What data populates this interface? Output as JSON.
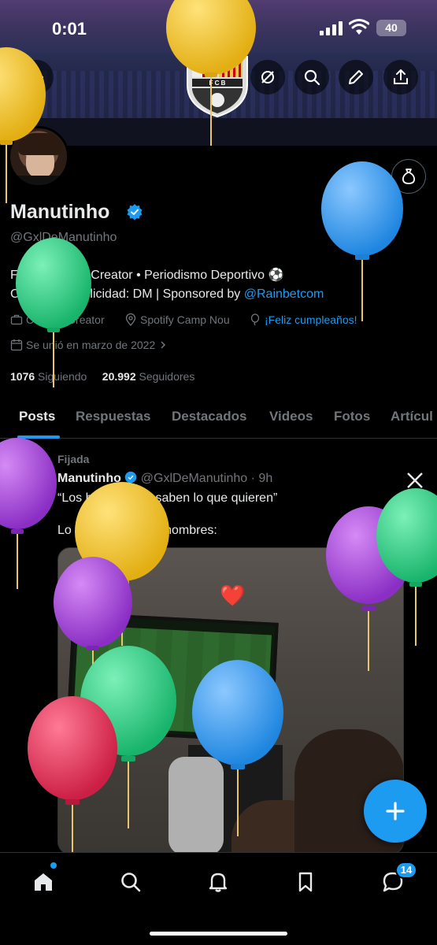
{
  "status_bar": {
    "time": "0:01",
    "battery": "40"
  },
  "profile": {
    "name": "Manutinho",
    "handle": "@GxlDeManutinho",
    "bio_line1": "FC Barcelona Creator • Periodismo Deportivo ⚽️",
    "bio_line2_prefix": "Collabs & Publicidad: DM | Sponsored by ",
    "bio_link": "@Rainbetcom",
    "category": "Content Creator",
    "location": "Spotify Camp Nou",
    "birthday": "¡Feliz cumpleaños!",
    "joined": "Se unió en marzo de 2022",
    "following_count": "1076",
    "following_label": "Siguiendo",
    "followers_count": "20.992",
    "followers_label": "Seguidores"
  },
  "tabs": [
    "Posts",
    "Respuestas",
    "Destacados",
    "Videos",
    "Fotos",
    "Artícul"
  ],
  "post": {
    "pinned_label": "Fijada",
    "author": "Manutinho",
    "meta": "@GxlDeManutinho · 9h",
    "text_line1": "“Los hombres no saben lo que quieren”",
    "text_line2": "Lo que quieren los hombres:",
    "media_emoji": "❤️"
  },
  "nav": {
    "messages_badge": "14"
  },
  "colors": {
    "accent": "#1d9bf0",
    "balloon_yellow": "#f2c230",
    "balloon_green": "#2ecf85",
    "balloon_blue": "#3b9ef0",
    "balloon_purple": "#a44ad8",
    "balloon_red": "#e8335a"
  }
}
